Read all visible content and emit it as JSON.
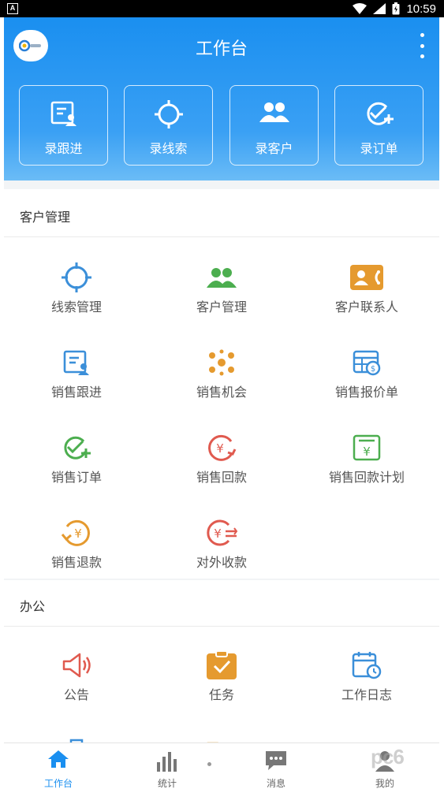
{
  "status_bar": {
    "time": "10:59",
    "left_badge": "A"
  },
  "header": {
    "title": "工作台",
    "quick_actions": [
      {
        "label": "录跟进",
        "icon": "follow-up-icon"
      },
      {
        "label": "录线索",
        "icon": "target-icon"
      },
      {
        "label": "录客户",
        "icon": "people-icon"
      },
      {
        "label": "录订单",
        "icon": "check-plus-icon"
      }
    ]
  },
  "sections": [
    {
      "title": "客户管理",
      "items": [
        {
          "label": "线索管理",
          "icon": "target-icon",
          "color": "#3b8fd9"
        },
        {
          "label": "客户管理",
          "icon": "people-icon",
          "color": "#4cae4f"
        },
        {
          "label": "客户联系人",
          "icon": "contact-card-icon",
          "color": "#e59a2f"
        },
        {
          "label": "销售跟进",
          "icon": "follow-up-icon",
          "color": "#3b8fd9"
        },
        {
          "label": "销售机会",
          "icon": "opportunity-icon",
          "color": "#e59a2f"
        },
        {
          "label": "销售报价单",
          "icon": "quote-icon",
          "color": "#3b8fd9"
        },
        {
          "label": "销售订单",
          "icon": "check-plus-icon",
          "color": "#4cae4f"
        },
        {
          "label": "销售回款",
          "icon": "payment-icon",
          "color": "#e05a4f"
        },
        {
          "label": "销售回款计划",
          "icon": "payment-plan-icon",
          "color": "#4cae4f"
        },
        {
          "label": "销售退款",
          "icon": "refund-icon",
          "color": "#e59a2f"
        },
        {
          "label": "对外收款",
          "icon": "collection-icon",
          "color": "#e05a4f"
        }
      ]
    },
    {
      "title": "办公",
      "items": [
        {
          "label": "公告",
          "icon": "megaphone-icon",
          "color": "#e05a4f"
        },
        {
          "label": "任务",
          "icon": "task-icon",
          "color": "#e59a2f"
        },
        {
          "label": "工作日志",
          "icon": "calendar-clock-icon",
          "color": "#3b8fd9"
        }
      ]
    }
  ],
  "tabbar": [
    {
      "label": "工作台",
      "icon": "home-icon",
      "active": true
    },
    {
      "label": "统计",
      "icon": "bar-chart-icon",
      "active": false
    },
    {
      "label": "消息",
      "icon": "message-icon",
      "active": false
    },
    {
      "label": "我的",
      "icon": "person-icon",
      "active": false
    }
  ],
  "watermark": "pc6"
}
